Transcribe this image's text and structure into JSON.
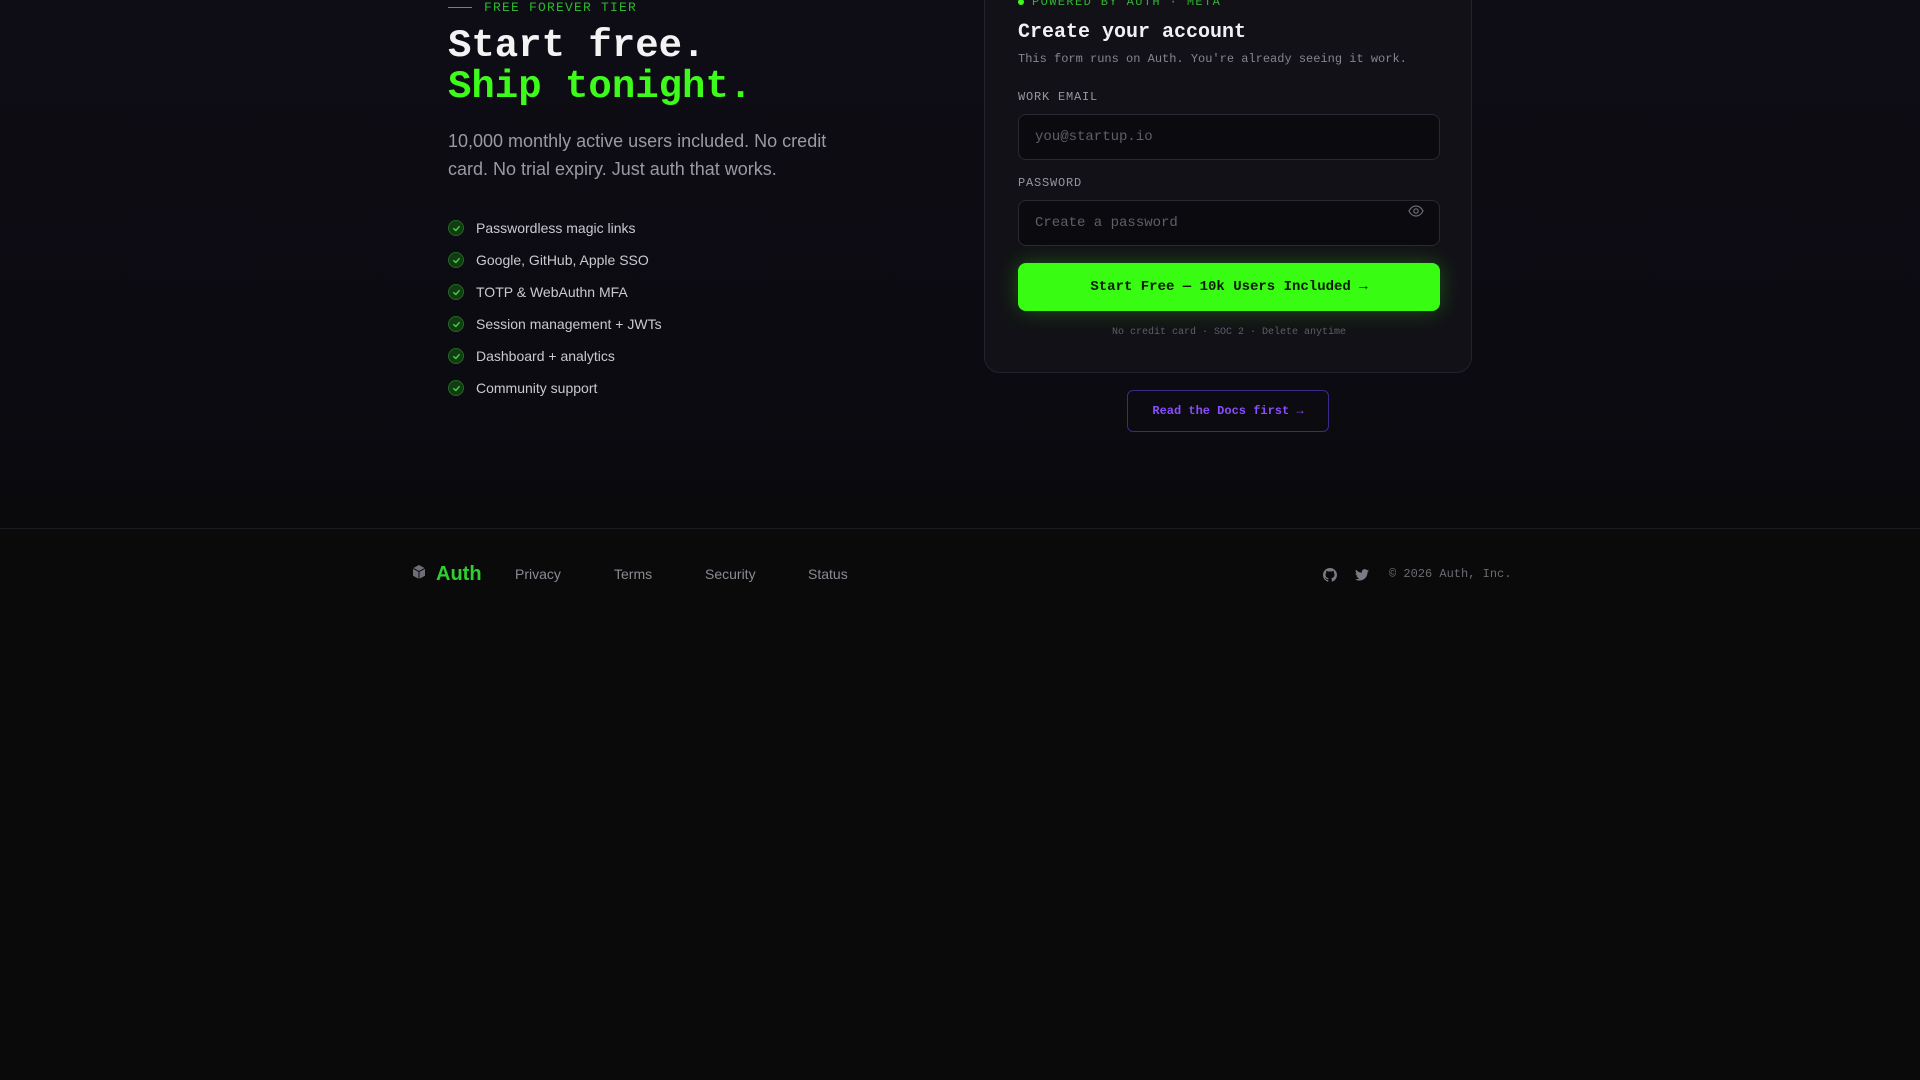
{
  "hero": {
    "eyebrow": "FREE FOREVER TIER",
    "title_line1": "Start free.",
    "title_line2": "Ship tonight.",
    "lede": "10,000 monthly active users included. No credit card. No trial expiry. Just auth that works.",
    "features": [
      "Passwordless magic links",
      "Google, GitHub, Apple SSO",
      "TOTP & WebAuthn MFA",
      "Session management + JWTs",
      "Dashboard + analytics",
      "Community support"
    ]
  },
  "signup": {
    "powered_by": "POWERED BY AUTH · META",
    "title": "Create your account",
    "subtitle": "This form runs on Auth. You're already seeing it work.",
    "email_label": "WORK EMAIL",
    "email_placeholder": "you@startup.io",
    "email_value": "",
    "password_label": "PASSWORD",
    "password_placeholder": "Create a password",
    "password_value": "",
    "password_toggle_icon": "eye-icon",
    "cta_label": "Start Free — 10k Users Included →",
    "fineprint": "No credit card · SOC 2 · Delete anytime"
  },
  "docs_button_label": "Read the Docs first →",
  "footer": {
    "brand": "Auth",
    "links": [
      "Privacy",
      "Terms",
      "Security",
      "Status"
    ],
    "social_icons": [
      "github-icon",
      "twitter-icon"
    ],
    "copyright": "© 2026 Auth, Inc."
  },
  "colors": {
    "accent": "#3dfc1c",
    "accent_dim": "#2fb62f",
    "docs_purple": "#8a4dff",
    "background": "#0a0a0b",
    "card": "#121117"
  }
}
